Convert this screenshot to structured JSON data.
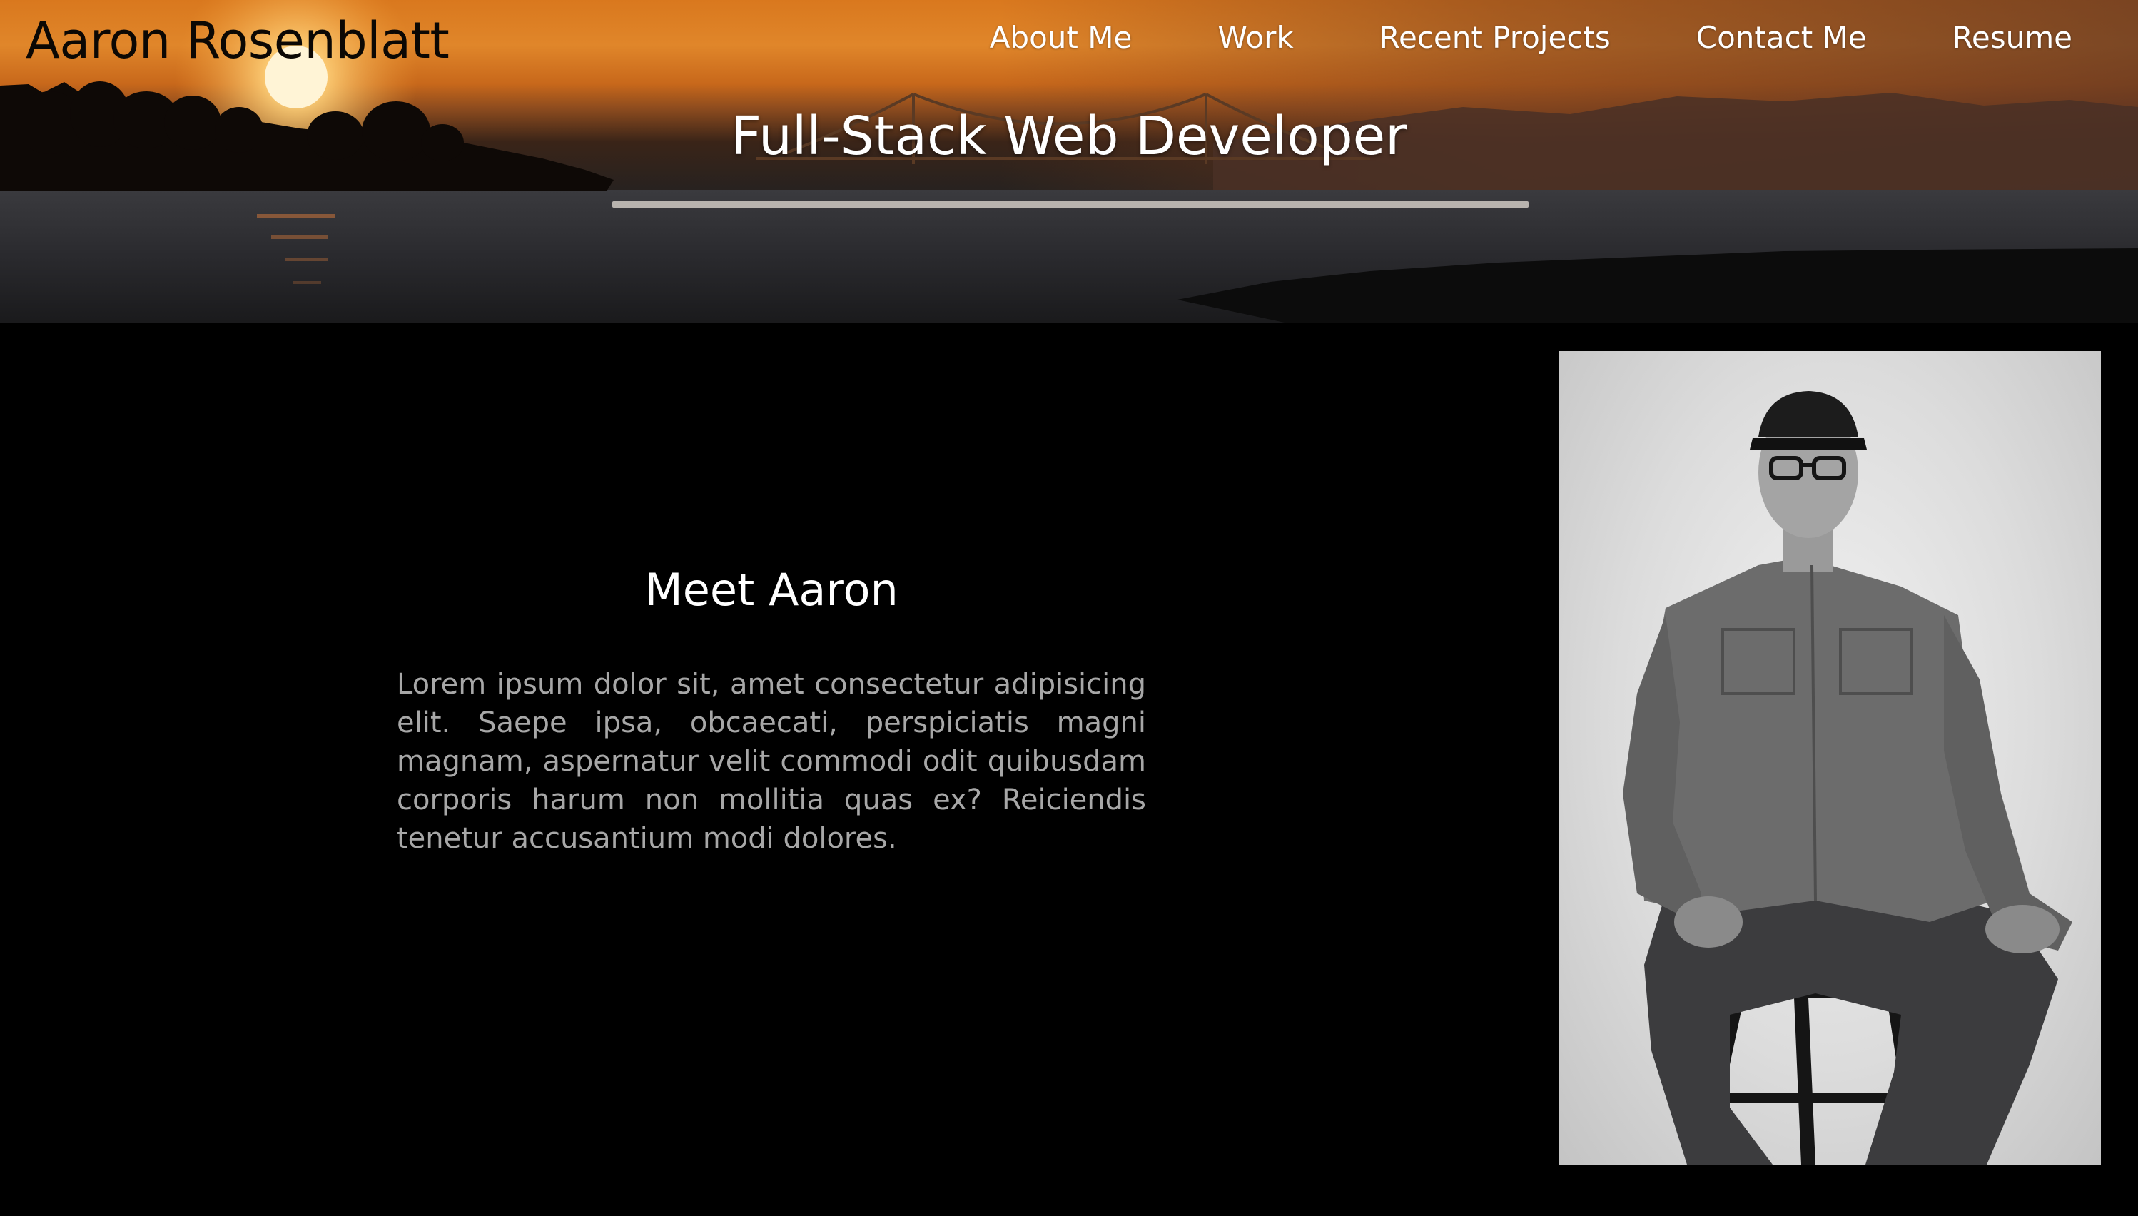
{
  "header": {
    "brand": "Aaron Rosenblatt",
    "nav": [
      {
        "label": "About Me"
      },
      {
        "label": "Work"
      },
      {
        "label": "Recent Projects"
      },
      {
        "label": "Contact Me"
      },
      {
        "label": "Resume"
      }
    ],
    "tagline": "Full-Stack Web Developer"
  },
  "about": {
    "title": "Meet Aaron",
    "body": "Lorem ipsum dolor sit, amet consectetur adipisicing elit. Saepe ipsa, obcaecati, perspiciatis magni magnam, aspernatur velit commodi odit quibusdam corporis harum non mollitia quas ex? Reiciendis tenetur accusantium modi dolores."
  },
  "colors": {
    "page_background": "#000000",
    "text_primary": "#ffffff",
    "text_body": "#a7a7a7",
    "underline": "#b8b3ae",
    "sunset": "#e0862a"
  },
  "icons": {
    "portrait": "portrait-photo"
  }
}
